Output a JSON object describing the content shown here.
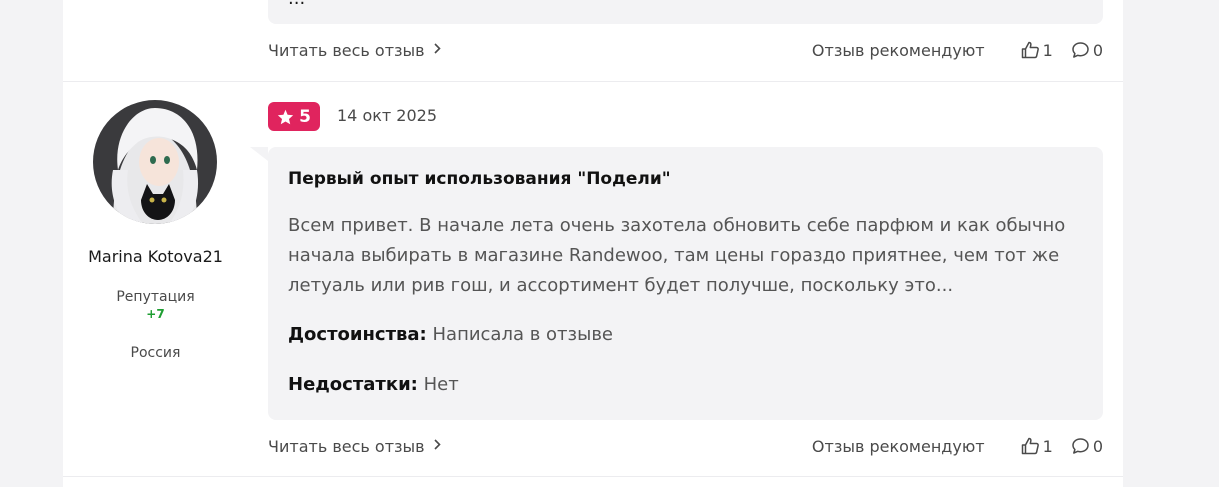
{
  "previous_review": {
    "text_fragment": "...",
    "read_more": "Читать весь отзыв",
    "recommend_label": "Отзыв рекомендуют",
    "likes": "1",
    "comments": "0"
  },
  "review": {
    "user": {
      "name": "Marina Kotova21",
      "reputation_label": "Репутация",
      "reputation_value": "+7",
      "country": "Россия"
    },
    "rating": "5",
    "date": "14 окт 2025",
    "title": "Первый опыт использования \"Подели\"",
    "text": "Всем привет. В начале лета очень захотела обновить себе парфюм и как обычно начала выбирать в магазине Randewoo, там цены гораздо приятнее, чем тот же летуаль или рив гош, и ассортимент будет получше, поскольку это...",
    "pros_label": "Достоинства:",
    "pros": "Написала в отзыве",
    "cons_label": "Недостатки:",
    "cons": "Нет",
    "read_more": "Читать весь отзыв",
    "recommend_label": "Отзыв рекомендуют",
    "likes": "1",
    "comments": "0"
  },
  "colors": {
    "accent": "#e0245e",
    "reputation_positive": "#1e9e32",
    "bubble_bg": "#f3f3f5",
    "page_bg": "#f3f3f5"
  },
  "icons": {
    "star": "star-icon",
    "chevron": "chevron-right-icon",
    "like": "thumb-up-icon",
    "comment": "comment-icon"
  }
}
